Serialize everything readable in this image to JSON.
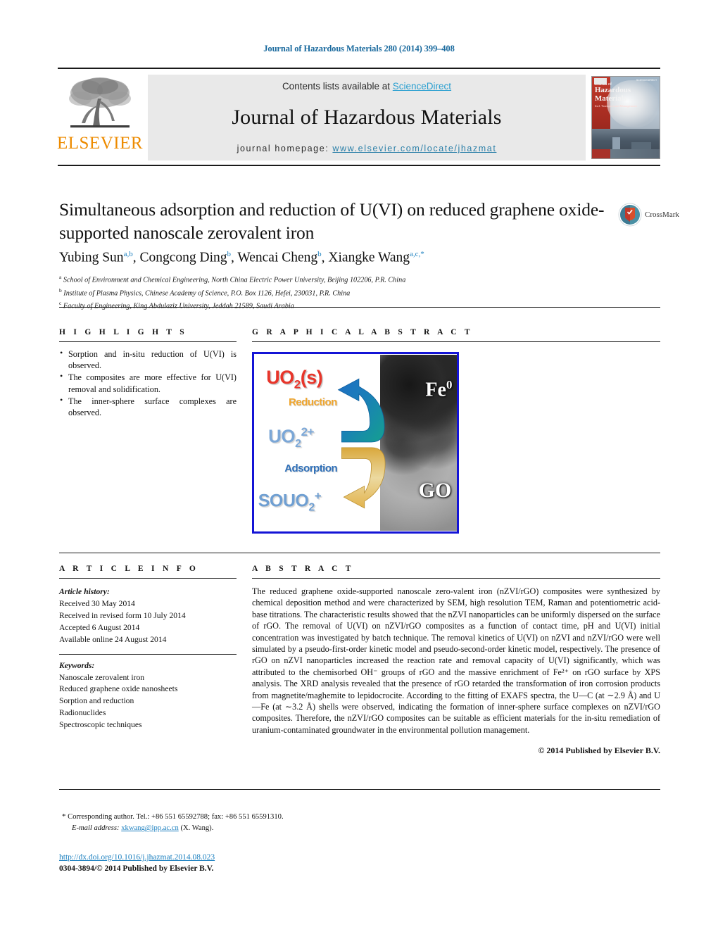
{
  "running_head": "Journal of Hazardous Materials 280 (2014) 399–408",
  "masthead": {
    "contents_prefix": "Contents lists available at ",
    "sciencedirect_link": "ScienceDirect",
    "journal_title": "Journal of Hazardous Materials",
    "homepage_prefix": "journal homepage: ",
    "homepage_link": "www.elsevier.com/locate/jhazmat",
    "publisher_wordmark": "ELSEVIER",
    "cover": {
      "line1": "Journal of",
      "line2": "Hazardous",
      "line3": "Materials",
      "line4": "Incl. Transport and Management",
      "header": "AVAILABLE ONLINE AT\nWWW.SCIENCEDIRECT.COM"
    },
    "colors": {
      "link_blue": "#2a9fd0",
      "homepage_blue": "#2a7fa8",
      "elsevier_orange": "#ED8B00",
      "band_gray": "#e9e9e9"
    }
  },
  "article": {
    "title": "Simultaneous adsorption and reduction of U(VI) on reduced graphene oxide-supported nanoscale zerovalent iron",
    "crossmark_label": "CrossMark",
    "authors": [
      {
        "name": "Yubing Sun",
        "sup": "a,b",
        "sep": ", "
      },
      {
        "name": "Congcong Ding",
        "sup": "b",
        "sep": ", "
      },
      {
        "name": "Wencai Cheng",
        "sup": "b",
        "sep": ", "
      },
      {
        "name": "Xiangke Wang",
        "sup": "a,c,*",
        "sep": ""
      }
    ],
    "affiliations": [
      {
        "marker": "a",
        "text": "School of Environment and Chemical Engineering, North China Electric Power University, Beijing 102206, P.R. China"
      },
      {
        "marker": "b",
        "text": "Institute of Plasma Physics, Chinese Academy of Science, P.O. Box 1126, Hefei, 230031, P.R. China"
      },
      {
        "marker": "c",
        "text": "Faculty of Engineering, King Abdulaziz University, Jeddah 21589, Saudi Arabia"
      }
    ]
  },
  "highlights": {
    "heading": "H I G H L I G H T S",
    "items": [
      "Sorption and in-situ reduction of U(VI) is observed.",
      "The composites are more effective for U(VI) removal and solidification.",
      "The inner-sphere surface complexes are observed."
    ]
  },
  "graphical_abstract": {
    "heading": "G R A P H I C A L   A B S T R A C T",
    "labels": {
      "uo2_solid": "UO",
      "uo2_solid_sub": "2",
      "uo2_solid_tail": "(s)",
      "reduction": "Reduction",
      "uo2_ion": "UO",
      "uo2_ion_sub": "2",
      "uo2_ion_sup": "2+",
      "adsorption": "Adsorption",
      "souo2": "SOUO",
      "souo2_sub": "2",
      "souo2_sup": "+",
      "fe0": "Fe",
      "fe0_sup": "0",
      "go": "GO"
    },
    "colors": {
      "frame_blue": "#1414d6",
      "uo2_red": "#e8352a",
      "reduction_orange": "#f0a62e",
      "uo2_ion_blue": "#7ba7d7",
      "adsorption_blue": "#2e6fb8",
      "souo2_blue": "#6f9fd2",
      "arrow_blue": "#1f6fc4",
      "arrow_teal": "#16a08c",
      "arrow_gold": "#e2b34d"
    }
  },
  "article_info": {
    "heading": "A R T I C L E   I N F O",
    "history_label": "Article history:",
    "history": [
      "Received 30 May 2014",
      "Received in revised form 10 July 2014",
      "Accepted 6 August 2014",
      "Available online 24 August 2014"
    ],
    "keywords_label": "Keywords:",
    "keywords": [
      "Nanoscale zerovalent iron",
      "Reduced graphene oxide nanosheets",
      "Sorption and reduction",
      "Radionuclides",
      "Spectroscopic techniques"
    ]
  },
  "abstract": {
    "heading": "A B S T R A C T",
    "text": "The reduced graphene oxide-supported nanoscale zero-valent iron (nZVI/rGO) composites were synthesized by chemical deposition method and were characterized by SEM, high resolution TEM, Raman and potentiometric acid-base titrations. The characteristic results showed that the nZVI nanoparticles can be uniformly dispersed on the surface of rGO. The removal of U(VI) on nZVI/rGO composites as a function of contact time, pH and U(VI) initial concentration was investigated by batch technique. The removal kinetics of U(VI) on nZVI and nZVI/rGO were well simulated by a pseudo-first-order kinetic model and pseudo-second-order kinetic model, respectively. The presence of rGO on nZVI nanoparticles increased the reaction rate and removal capacity of U(VI) significantly, which was attributed to the chemisorbed OH⁻ groups of rGO and the massive enrichment of Fe²⁺ on rGO surface by XPS analysis. The XRD analysis revealed that the presence of rGO retarded the transformation of iron corrosion products from magnetite/maghemite to lepidocrocite. According to the fitting of EXAFS spectra, the U—C (at ∼2.9 Å) and U—Fe (at ∼3.2 Å) shells were observed, indicating the formation of inner-sphere surface complexes on nZVI/rGO composites. Therefore, the nZVI/rGO composites can be suitable as efficient materials for the in-situ remediation of uranium-contaminated groundwater in the environmental pollution management.",
    "copyright": "© 2014 Published by Elsevier B.V."
  },
  "footer": {
    "corresponding_marker": "*",
    "corresponding_text": "Corresponding author. Tel.: +86 551 65592788; fax: +86 551 65591310.",
    "email_label": "E-mail address:",
    "email": "xkwang@ipp.ac.cn",
    "email_suffix": "(X. Wang).",
    "doi": "http://dx.doi.org/10.1016/j.jhazmat.2014.08.023",
    "issn_line": "0304-3894/© 2014 Published by Elsevier B.V."
  }
}
